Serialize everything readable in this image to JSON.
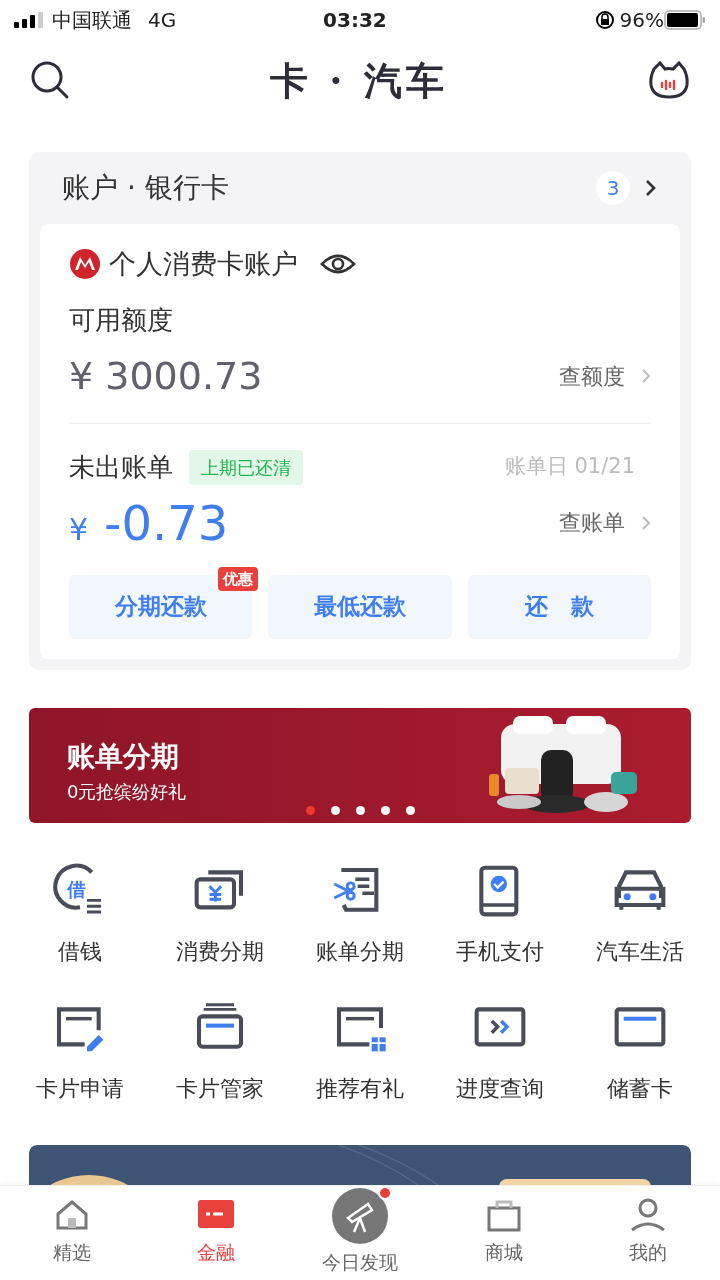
{
  "status_bar": {
    "carrier": "中国联通",
    "network": "4G",
    "time": "03:32",
    "battery": "96%"
  },
  "header": {
    "title": "卡 · 汽车"
  },
  "account": {
    "title": "账户 · 银行卡",
    "count": "3",
    "card": {
      "name": "个人消费卡账户",
      "available_label": "可用额度",
      "available": "¥ 3000.73",
      "quota_link": "查额度",
      "bill_label": "未出账单",
      "bill_tag": "上期已还清",
      "bill_date": "账单日 01/21",
      "bill_currency": "¥",
      "bill_amount": "-0.73",
      "bill_link": "查账单",
      "buttons": [
        {
          "label": "分期还款",
          "badge": "优惠"
        },
        {
          "label": "最低还款"
        },
        {
          "label": "还　款"
        }
      ]
    }
  },
  "banner": {
    "title": "账单分期",
    "subtitle": "0元抢缤纷好礼",
    "dots": [
      {
        "selected": true
      },
      {
        "selected": false
      },
      {
        "selected": false
      },
      {
        "selected": false
      },
      {
        "selected": false
      }
    ]
  },
  "shortcuts": [
    {
      "kind": "borrow",
      "icon_text": "借",
      "label": "借钱"
    },
    {
      "kind": "installment",
      "label": "消费分期"
    },
    {
      "kind": "bill",
      "label": "账单分期"
    },
    {
      "kind": "phone",
      "label": "手机支付"
    },
    {
      "kind": "car",
      "label": "汽车生活"
    },
    {
      "kind": "apply",
      "label": "卡片申请"
    },
    {
      "kind": "manage",
      "label": "卡片管家"
    },
    {
      "kind": "refer",
      "label": "推荐有礼"
    },
    {
      "kind": "progress",
      "label": "进度查询"
    },
    {
      "kind": "debit",
      "label": "储蓄卡"
    }
  ],
  "tabs": [
    {
      "kind": "home",
      "label": "精选",
      "selected": false,
      "badge": false
    },
    {
      "kind": "finance",
      "label": "金融",
      "selected": true,
      "badge": false
    },
    {
      "kind": "discover",
      "label": "今日发现",
      "selected": false,
      "badge": true
    },
    {
      "kind": "shop",
      "label": "商城",
      "selected": false,
      "badge": false
    },
    {
      "kind": "me",
      "label": "我的",
      "selected": false,
      "badge": false
    }
  ]
}
